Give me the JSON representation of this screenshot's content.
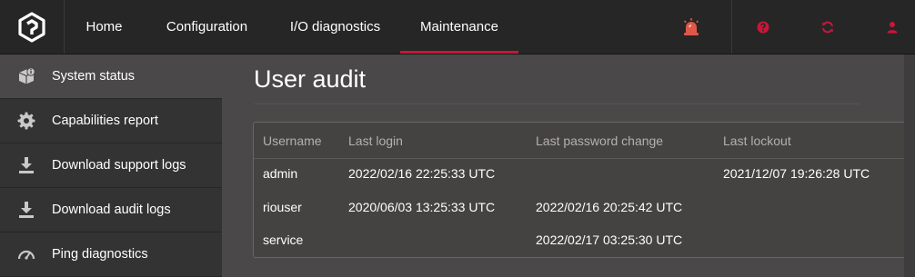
{
  "nav": {
    "items": [
      {
        "label": "Home",
        "active": false
      },
      {
        "label": "Configuration",
        "active": false
      },
      {
        "label": "I/O diagnostics",
        "active": false
      },
      {
        "label": "Maintenance",
        "active": true
      }
    ]
  },
  "topbar_icons": [
    "alarm-siren-icon",
    "help-icon",
    "refresh-icon",
    "user-icon"
  ],
  "colors": {
    "accent": "#c8163a",
    "topbar": "#262626",
    "sidebar": "#333333",
    "main": "#4a4848"
  },
  "sidebar": {
    "items": [
      {
        "label": "System status",
        "icon": "box-info-icon",
        "active": true
      },
      {
        "label": "Capabilities report",
        "icon": "gear-icon",
        "active": false
      },
      {
        "label": "Download support logs",
        "icon": "download-icon",
        "active": false
      },
      {
        "label": "Download audit logs",
        "icon": "download-icon",
        "active": false
      },
      {
        "label": "Ping diagnostics",
        "icon": "gauge-icon",
        "active": false
      }
    ]
  },
  "main": {
    "title": "User audit",
    "table": {
      "headers": [
        "Username",
        "Last login",
        "Last password change",
        "Last lockout"
      ],
      "rows": [
        {
          "username": "admin",
          "last_login": "2022/02/16 22:25:33 UTC",
          "last_password_change": "",
          "last_lockout": "2021/12/07 19:26:28 UTC"
        },
        {
          "username": "riouser",
          "last_login": "2020/06/03 13:25:33 UTC",
          "last_password_change": "2022/02/16 20:25:42 UTC",
          "last_lockout": ""
        },
        {
          "username": "service",
          "last_login": "",
          "last_password_change": "2022/02/17 03:25:30 UTC",
          "last_lockout": ""
        }
      ]
    }
  }
}
